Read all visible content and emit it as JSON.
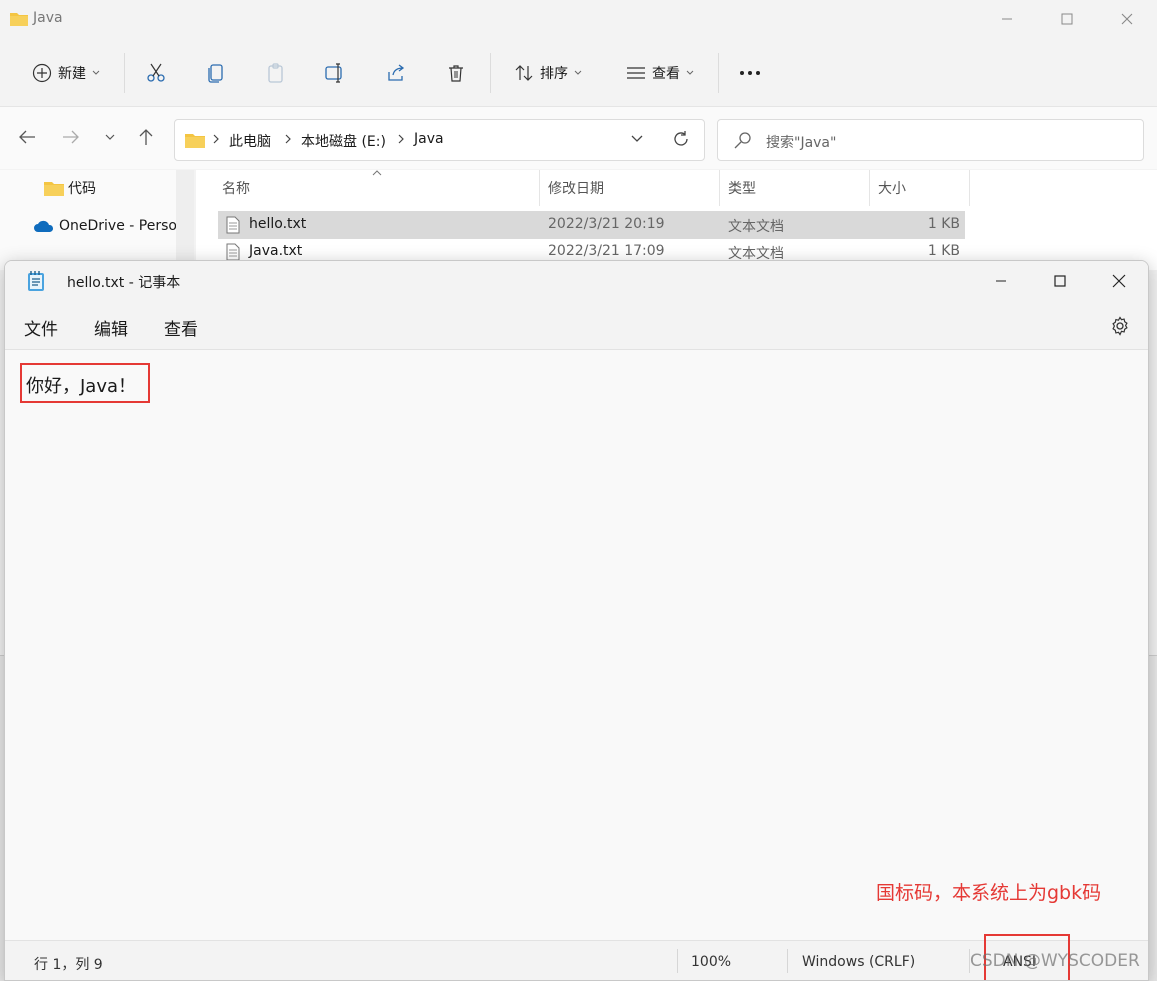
{
  "explorer": {
    "title": "Java",
    "toolbar": {
      "new_label": "新建",
      "sort_label": "排序",
      "view_label": "查看"
    },
    "breadcrumb": [
      "此电脑",
      "本地磁盘 (E:)",
      "Java"
    ],
    "search_placeholder": "搜索\"Java\"",
    "nav": {
      "items": [
        "代码",
        "OneDrive - Perso"
      ]
    },
    "columns": [
      "名称",
      "修改日期",
      "类型",
      "大小"
    ],
    "files": [
      {
        "name": "hello.txt",
        "date": "2022/3/21 20:19",
        "type": "文本文档",
        "size": "1 KB"
      },
      {
        "name": "Java.txt",
        "date": "2022/3/21 17:09",
        "type": "文本文档",
        "size": "1 KB"
      }
    ]
  },
  "notepad": {
    "title": "hello.txt - 记事本",
    "menu": [
      "文件",
      "编辑",
      "查看"
    ],
    "content": "你好，Java！",
    "annotation": "国标码，本系统上为gbk码",
    "status": {
      "position": "行 1，列 9",
      "zoom": "100%",
      "line_ending": "Windows (CRLF)",
      "encoding": "ANSI"
    },
    "watermark": "CSDN @WYSCODER"
  },
  "colors": {
    "highlight": "#e53935",
    "folder": "#f4c542",
    "selected_row": "#d9d9d9"
  }
}
